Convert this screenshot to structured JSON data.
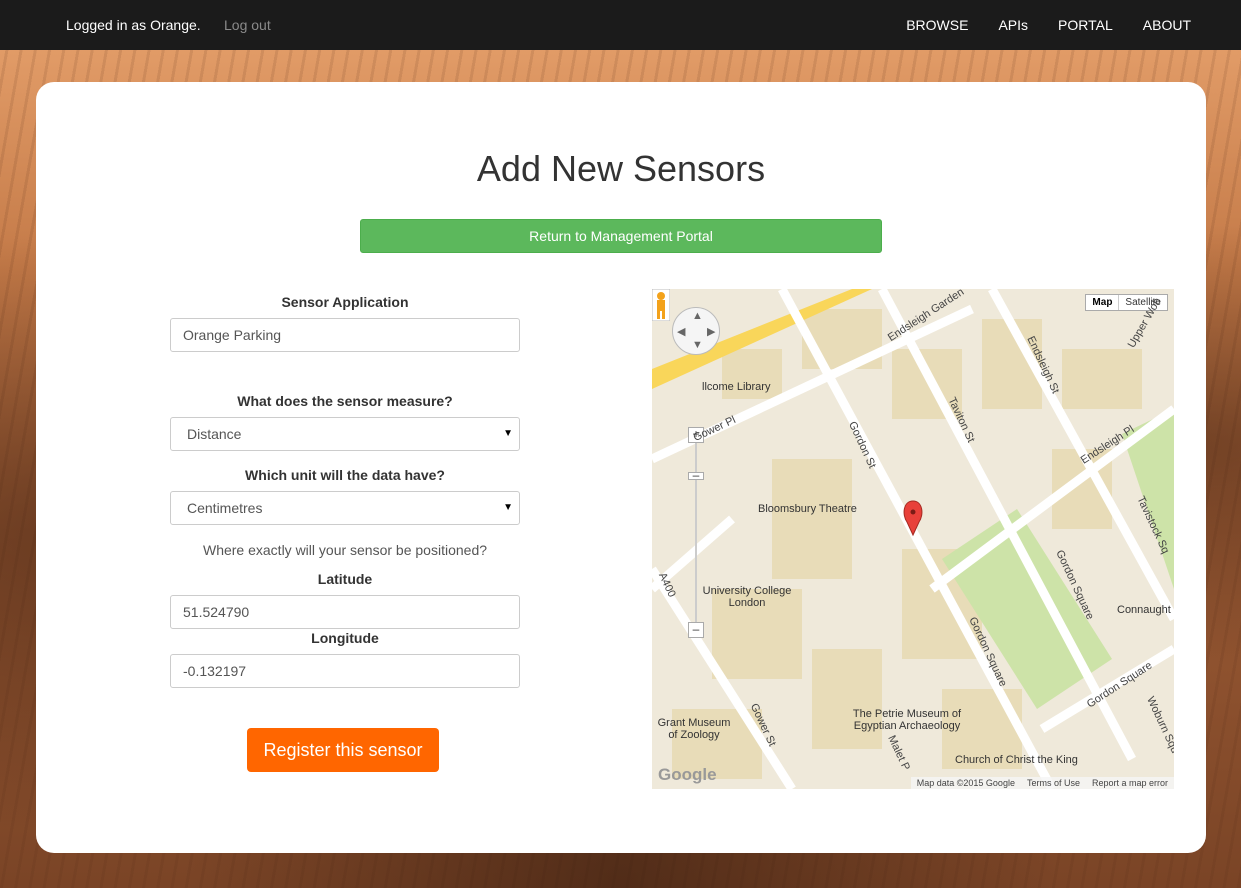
{
  "nav": {
    "user": "Logged in as Orange.",
    "logout": "Log out",
    "links": [
      "BROWSE",
      "APIs",
      "PORTAL",
      "ABOUT"
    ]
  },
  "page": {
    "title": "Add New Sensors",
    "return_button": "Return to Management Portal"
  },
  "form": {
    "app_label": "Sensor Application",
    "app_value": "Orange Parking",
    "measure_label": "What does the sensor measure?",
    "measure_value": "Distance",
    "unit_label": "Which unit will the data have?",
    "unit_value": "Centimetres",
    "position_note": "Where exactly will your sensor be positioned?",
    "lat_label": "Latitude",
    "lat_value": "51.524790",
    "lng_label": "Longitude",
    "lng_value": "-0.132197",
    "submit": "Register this sensor"
  },
  "map": {
    "type_map": "Map",
    "type_satellite": "Satellite",
    "labels": {
      "library": "llcome Library",
      "theatre": "Bloomsbury Theatre",
      "ucl": "University College London",
      "grant": "Grant Museum of Zoology",
      "petrie": "The Petrie Museum of Egyptian Archaeology",
      "church": "Church of Christ the King",
      "connaught": "Connaught"
    },
    "streets": {
      "gordon_st": "Gordon St",
      "tavit_st": "Taviton St",
      "endsleigh_st": "Endsleigh St",
      "endsleigh_pl": "Endsleigh Pl",
      "endsleigh_gdn": "Endsleigh Garden",
      "gower_pl": "Gower Pl",
      "gower_st": "Gower St",
      "gordon_sq_1": "Gordon Square",
      "gordon_sq_2": "Gordon Square",
      "gordon_sq_3": "Gordon Square",
      "tavistock": "Tavistock Sq",
      "woburn_sq": "Woburn Squ",
      "upper_wob": "Upper Wob",
      "a400": "A400",
      "malet": "Malet P"
    },
    "google": "Google",
    "footer": {
      "data": "Map data ©2015 Google",
      "terms": "Terms of Use",
      "report": "Report a map error"
    }
  }
}
